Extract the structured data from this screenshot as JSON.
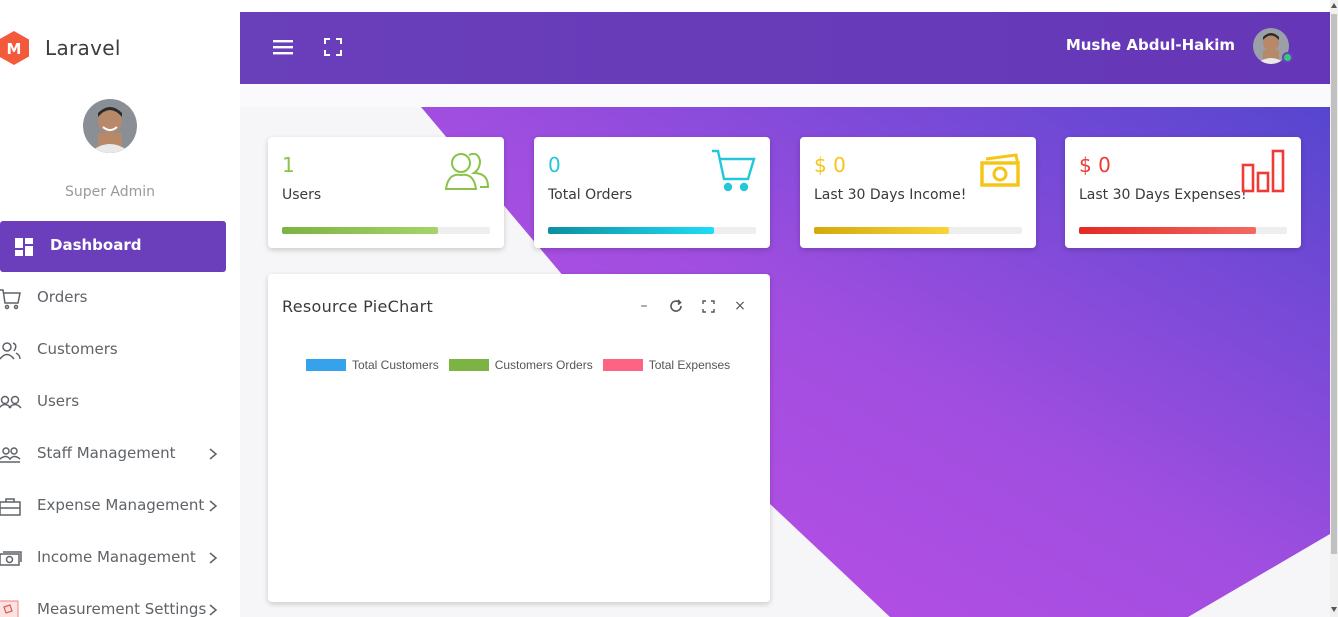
{
  "brand": {
    "name": "Laravel",
    "logo_letter": "M"
  },
  "sidebar": {
    "role": "Super Admin",
    "items": [
      {
        "label": "Dashboard",
        "icon": "dashboard-icon",
        "active": true
      },
      {
        "label": "Orders",
        "icon": "cart-icon"
      },
      {
        "label": "Customers",
        "icon": "customers-icon"
      },
      {
        "label": "Users",
        "icon": "users-icon"
      },
      {
        "label": "Staff Management",
        "icon": "staff-icon",
        "submenu": true
      },
      {
        "label": "Expense Management",
        "icon": "briefcase-icon",
        "submenu": true
      },
      {
        "label": "Income Management",
        "icon": "money-icon",
        "submenu": true
      },
      {
        "label": "Measurement Settings",
        "icon": "box-icon",
        "submenu": true
      }
    ]
  },
  "header": {
    "user_name": "Mushe Abdul-Hakim"
  },
  "cards": [
    {
      "value": "1",
      "label": "Users",
      "color": "#8bc34a",
      "progress": 0.75,
      "icon": "users-outline-icon"
    },
    {
      "value": "0",
      "label": "Total Orders",
      "color": "#26c6da",
      "progress": 0.8,
      "icon": "cart-icon"
    },
    {
      "value": "$ 0",
      "label": "Last 30 Days Income!",
      "color": "#f5c518",
      "progress": 0.65,
      "icon": "cash-icon"
    },
    {
      "value": "$ 0",
      "label": "Last 30 Days Expenses!",
      "color": "#ef3b36",
      "progress": 0.85,
      "icon": "bar-chart-icon"
    }
  ],
  "panel": {
    "title": "Resource PieChart",
    "tools": {
      "minimize": "–",
      "refresh": "⟳",
      "expand": "⛶",
      "close": "×"
    },
    "legend": [
      {
        "label": "Total Customers",
        "color": "#36a2eb"
      },
      {
        "label": "Customers Orders",
        "color": "#7cb342"
      },
      {
        "label": "Total Expenses",
        "color": "#ff6384"
      }
    ]
  },
  "colors": {
    "primary": "#6b3fbc",
    "purple_gradient_start": "#b94fe4",
    "purple_gradient_end": "#5a45c9"
  }
}
